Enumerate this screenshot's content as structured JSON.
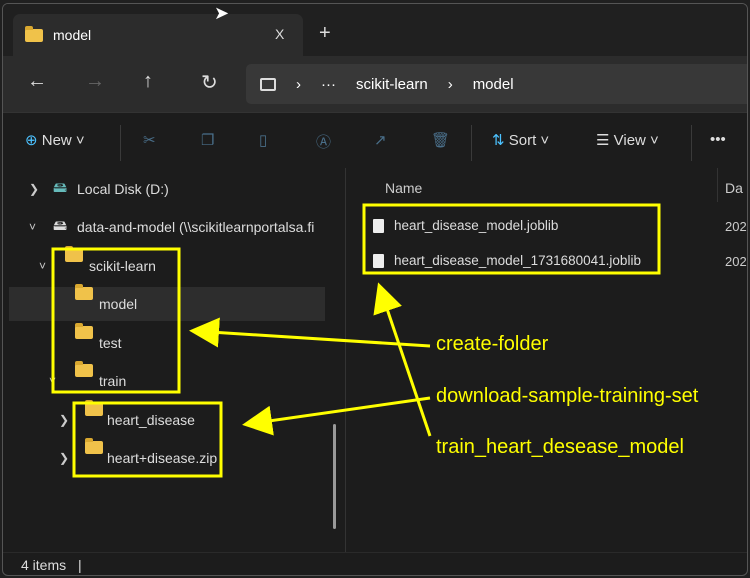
{
  "tab": {
    "title": "model",
    "close": "X",
    "new_tab": "+"
  },
  "nav": {
    "back": "←",
    "forward": "→",
    "up": "↑",
    "refresh": "↻"
  },
  "breadcrumb": {
    "more": "···",
    "items": [
      "scikit-learn",
      "model"
    ],
    "sep": "›"
  },
  "toolbar": {
    "new": "New",
    "sort": "Sort",
    "view": "View",
    "more": "•••"
  },
  "sidebar": {
    "items": [
      {
        "label": "Local Disk (D:)"
      },
      {
        "label": "data-and-model (\\\\scikitlearnportalsa.fi"
      },
      {
        "label": "scikit-learn"
      },
      {
        "label": "model"
      },
      {
        "label": "test"
      },
      {
        "label": "train"
      },
      {
        "label": "heart_disease"
      },
      {
        "label": "heart+disease.zip"
      }
    ]
  },
  "list": {
    "col_name": "Name",
    "col_date": "Da",
    "files": [
      {
        "name": "heart_disease_model.joblib",
        "date": "202"
      },
      {
        "name": "heart_disease_model_1731680041.joblib",
        "date": "202"
      }
    ]
  },
  "status": {
    "count": "4 items"
  },
  "annotations": [
    "create-folder",
    "download-sample-training-set",
    "train_heart_desease_model"
  ],
  "colors": {
    "annotation": "#ffff00"
  }
}
